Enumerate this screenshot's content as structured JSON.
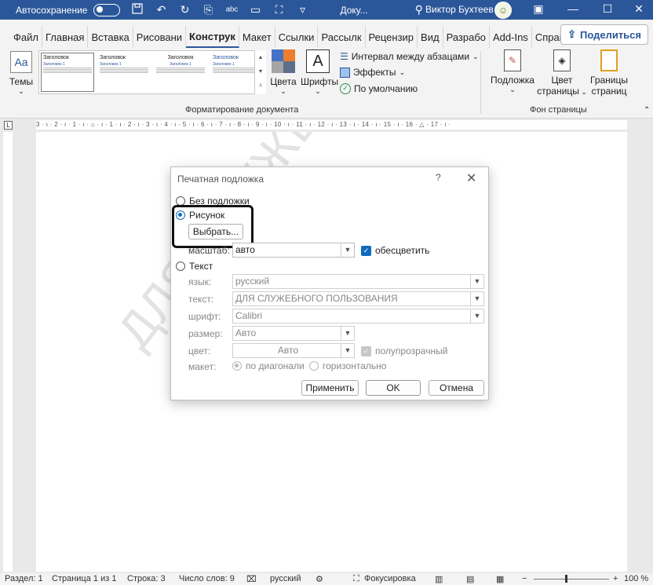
{
  "titlebar": {
    "autosave_label": "Автосохранение",
    "document": "Доку...",
    "user": "Виктор Бухтеев",
    "icons": [
      "save-icon",
      "undo-icon",
      "redo-icon",
      "search-icon",
      "ribbon-display-icon",
      "minimize-icon",
      "maximize-icon",
      "close-icon"
    ]
  },
  "ribbon_tabs": [
    "Файл",
    "Главная",
    "Вставка",
    "Рисовани",
    "Конструк",
    "Макет",
    "Ссылки",
    "Рассылк",
    "Рецензир",
    "Вид",
    "Разрабо",
    "Add-Ins",
    "Справка"
  ],
  "active_tab": "Конструк",
  "share_label": "Поделиться",
  "ribbon": {
    "themes_label": "Темы",
    "gallery": [
      {
        "title": "Заголовок",
        "heading": "Заголовок 1"
      },
      {
        "title": "Заголовок",
        "heading": "Заголовок 1"
      },
      {
        "title": "Заголовок",
        "heading": "Заголовок 1"
      },
      {
        "title": "Заголовок",
        "heading": "Заголовок 1"
      }
    ],
    "colors_label": "Цвета",
    "fonts_label": "Шрифты",
    "fonts_icon_letter": "A",
    "paragraph_spacing": "Интервал между абзацами",
    "effects": "Эффекты",
    "set_default": "По умолчанию",
    "group_doc_format": "Форматирование документа",
    "watermark_label": "Подложка",
    "page_color_line1": "Цвет",
    "page_color_line2": "страницы",
    "page_borders_line1": "Границы",
    "page_borders_line2": "страниц",
    "group_page_bg": "Фон страницы"
  },
  "ruler_text": "3 · ı · 2 · ı · 1 · ı · ⌂ · ı · 1 · ı · 2 · ı · 3 · ı · 4 · ı · 5 · ı · 6 · ı · 7 · ı · 8 · ı · 9 · ı · 10 · ı · 11 · ı · 12 · ı · 13 · ı · 14 · ı · 15 · ı · 16 · △ · 17 · ı ·",
  "watermark_text": "ДЛЯ СЛУЖЕБНОГО ПОЛЬЗОВАНИЯ",
  "dialog": {
    "title": "Печатная подложка",
    "help": "?",
    "no_watermark": "Без подложки",
    "picture": "Рисунок",
    "select_button": "Выбрать...",
    "scale_label": "масштаб:",
    "scale_value": "авто",
    "washout_label": "обесцветить",
    "text_option": "Текст",
    "language_label": "язык:",
    "language_value": "русский",
    "text_label": "текст:",
    "text_value": "ДЛЯ СЛУЖЕБНОГО ПОЛЬЗОВАНИЯ",
    "font_label": "шрифт:",
    "font_value": "Calibri",
    "size_label": "размер:",
    "size_value": "Авто",
    "color_label": "цвет:",
    "color_value": "Авто",
    "semitransparent_label": "полупрозрачный",
    "layout_label": "макет:",
    "diagonal_label": "по диагонали",
    "horizontal_label": "горизонтально",
    "apply_button": "Применить",
    "ok_button": "OK",
    "cancel_button": "Отмена"
  },
  "statusbar": {
    "section": "Раздел: 1",
    "page": "Страница 1 из 1",
    "line": "Строка: 3",
    "words": "Число слов: 9",
    "language": "русский",
    "focus": "Фокусировка",
    "zoom": "100 %"
  }
}
